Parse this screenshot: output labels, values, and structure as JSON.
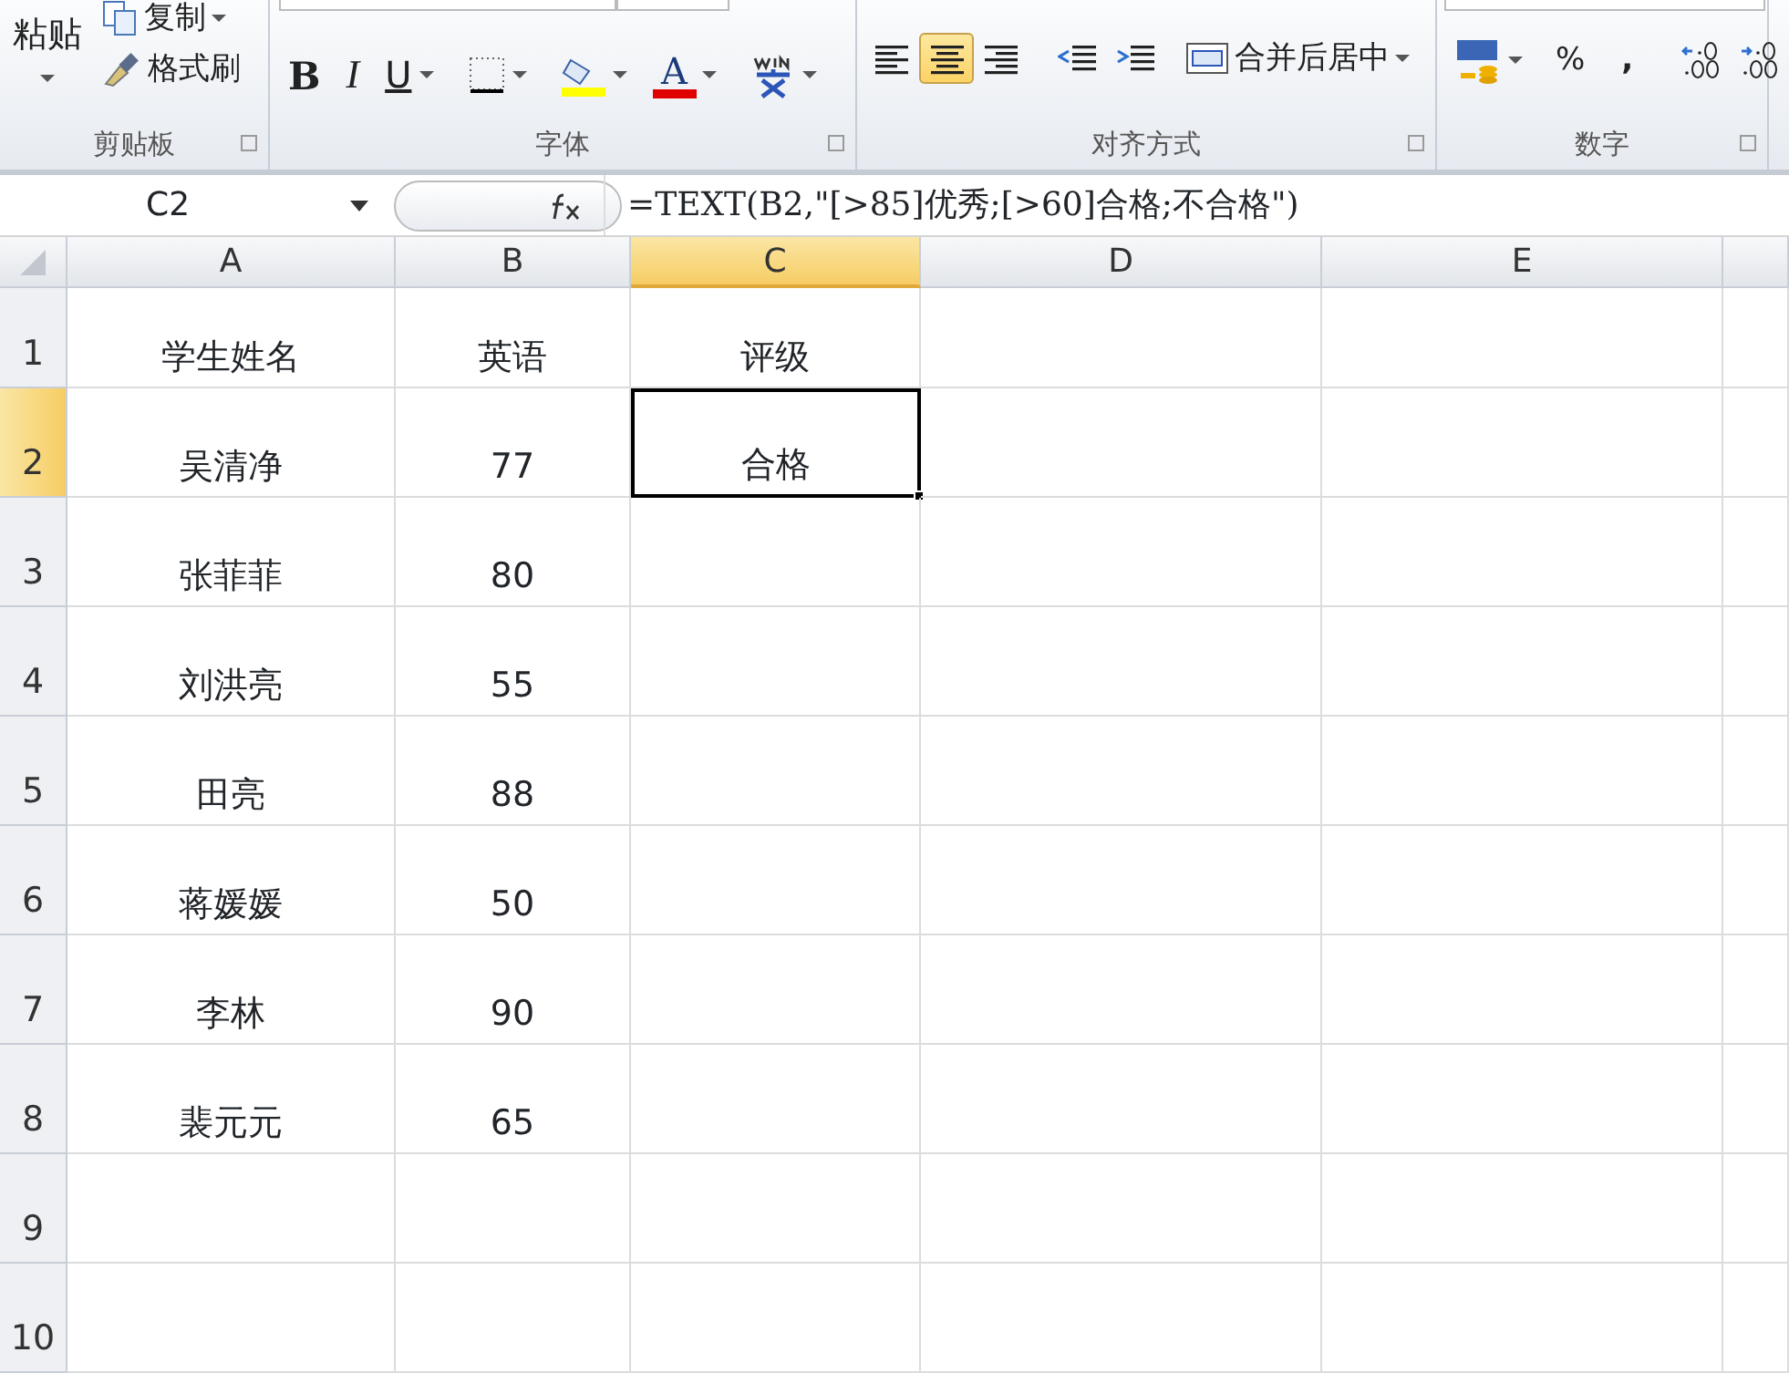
{
  "ribbon": {
    "clipboard": {
      "paste": "粘贴",
      "copy": "复制",
      "format_painter": "格式刷",
      "label": "剪贴板"
    },
    "font": {
      "bold": "B",
      "italic": "I",
      "underline": "U",
      "font_color": "A",
      "label": "字体"
    },
    "alignment": {
      "align_buttons": [
        {
          "kind": "left",
          "selected": false
        },
        {
          "kind": "center",
          "selected": true
        },
        {
          "kind": "right",
          "selected": false
        }
      ],
      "merge": "合并后居中",
      "label": "对齐方式"
    },
    "number": {
      "percent": "%",
      "comma": ",",
      "label": "数字"
    }
  },
  "formula_bar": {
    "name_box": "C2",
    "formula": "=TEXT(B2,\"[>85]优秀;[>60]合格;不合格\")"
  },
  "sheet": {
    "columns": [
      {
        "label": "A",
        "selected": false
      },
      {
        "label": "B",
        "selected": false
      },
      {
        "label": "C",
        "selected": true
      },
      {
        "label": "D",
        "selected": false
      },
      {
        "label": "E",
        "selected": false
      }
    ],
    "rows": [
      {
        "label": "1",
        "selected": false,
        "cells": [
          "学生姓名",
          "英语",
          "评级"
        ]
      },
      {
        "label": "2",
        "selected": true,
        "cells": [
          "吴清净",
          "77",
          "合格"
        ]
      },
      {
        "label": "3",
        "selected": false,
        "cells": [
          "张菲菲",
          "80",
          ""
        ]
      },
      {
        "label": "4",
        "selected": false,
        "cells": [
          "刘洪亮",
          "55",
          ""
        ]
      },
      {
        "label": "5",
        "selected": false,
        "cells": [
          "田亮",
          "88",
          ""
        ]
      },
      {
        "label": "6",
        "selected": false,
        "cells": [
          "蒋媛媛",
          "50",
          ""
        ]
      },
      {
        "label": "7",
        "selected": false,
        "cells": [
          "李林",
          "90",
          ""
        ]
      },
      {
        "label": "8",
        "selected": false,
        "cells": [
          "裴元元",
          "65",
          ""
        ]
      },
      {
        "label": "9",
        "selected": false,
        "cells": [
          "",
          "",
          ""
        ]
      },
      {
        "label": "10",
        "selected": false,
        "cells": [
          "",
          "",
          ""
        ]
      }
    ]
  }
}
